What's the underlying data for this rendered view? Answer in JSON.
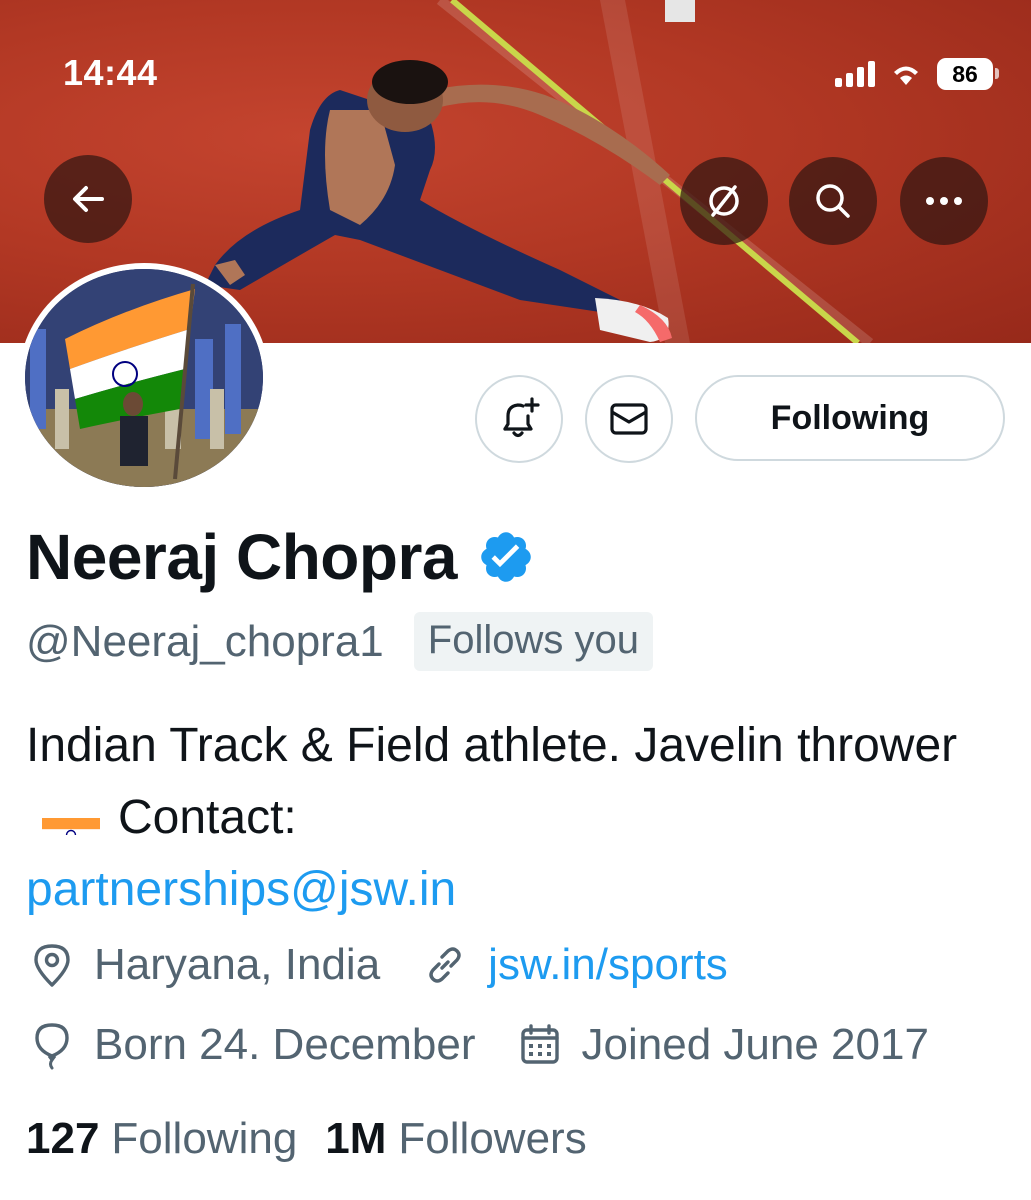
{
  "status_bar": {
    "time": "14:44",
    "battery": "86"
  },
  "profile": {
    "name": "Neeraj Chopra",
    "handle": "@Neeraj_chopra1",
    "follows_you": "Follows you",
    "bio_text": "Indian Track & Field athlete. Javelin thrower",
    "bio_contact_label": "Contact:",
    "bio_email": "partnerships@jsw.in",
    "location": "Haryana, India",
    "website": "jsw.in/sports",
    "birthday": "Born 24. December",
    "joined": "Joined June 2017"
  },
  "actions": {
    "following_label": "Following"
  },
  "stats": {
    "following_count": "127",
    "following_label": "Following",
    "followers_count": "1M",
    "followers_label": "Followers"
  },
  "colors": {
    "link": "#1d9bf0",
    "verified": "#1d9bf0",
    "secondary_text": "#536471"
  },
  "icons": [
    "back-arrow-icon",
    "mute-icon",
    "search-icon",
    "more-icon",
    "notification-bell-icon",
    "mail-icon",
    "verified-badge-icon",
    "location-pin-icon",
    "link-icon",
    "balloon-icon",
    "calendar-icon"
  ]
}
